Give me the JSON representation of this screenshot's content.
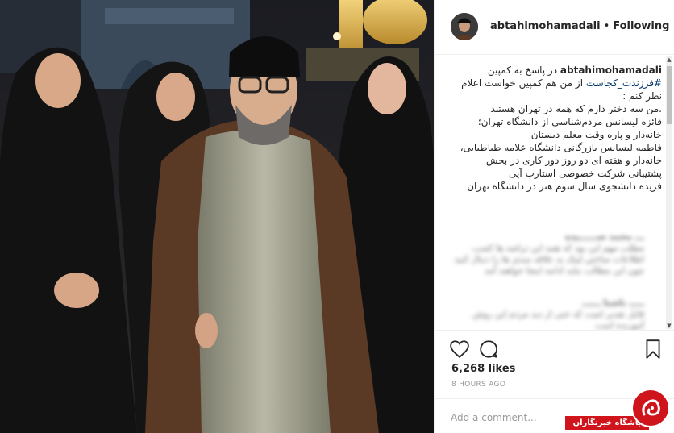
{
  "post": {
    "username": "abtahimohamadali",
    "separator": "•",
    "follow_status": "Following",
    "caption_user": "abtahimohamadali",
    "caption_line1": "در پاسخ به کمپین",
    "caption_hashtag": "#فرزندت_کجاست",
    "caption_rest": "از من هم کمپین خواست اعلام نظر کنم :",
    "caption_p2": ".من سه دختر دارم که همه در تهران هستند",
    "caption_p3": "فائزه لیسانس مردم‌شناسی از دانشگاه تهران؛ خانه‌دار و پاره وقت معلم دبستان",
    "caption_p4": "فاطمه لیسانس بازرگانی دانشگاه علامه طباطبایی، خانه‌دار و هفته ای دو روز دور کاری در بخش پشتیبانی شرکت خصوصی استارت آپی",
    "caption_p5": "فریده دانشجوی سال سوم هنر در دانشگاه تهران",
    "likes": "6,268 likes",
    "time": "8 HOURS AGO",
    "comment_placeholder": "Add a comment..."
  },
  "blurred_comments": [
    {
      "text": "ـــ محمد ســــــیده"
    },
    {
      "text": "مطلب مهم این بود که همه این تراشه ها کسب اطلاعات ساختن لینک به علاقه مندی ها را دنبال کنید چون این مطالب نباید ادامه اینجا خواهند آمد"
    },
    {
      "text": "ـــــ ناشنا ــــــ"
    },
    {
      "text": "قابل تقدیر است که حتی از دید مردم این روش آموزنده است"
    }
  ],
  "icons": {
    "like": "heart-icon",
    "comment": "comment-icon",
    "save": "bookmark-icon"
  },
  "watermark": {
    "text": "باشگاه خبرنگاران"
  },
  "colors": {
    "accent": "#003569",
    "watermark_red": "#d0141b"
  }
}
